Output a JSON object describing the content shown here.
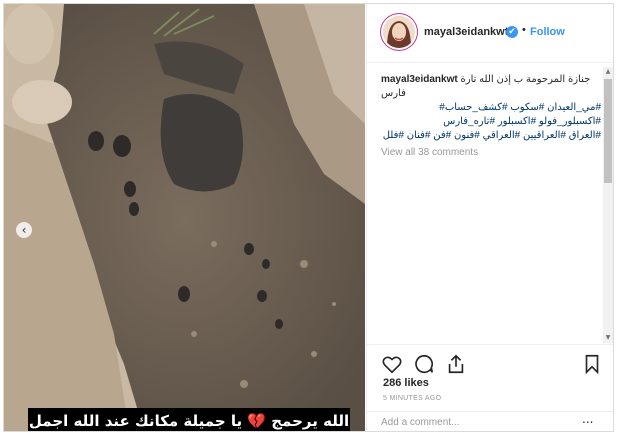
{
  "post": {
    "media": {
      "image_description": "muddy ground, carousel post",
      "overlay_caption": "الله يرحمج 💔 يا جميلة مكانك عند الله اجمل",
      "carousel_prev_icon": "chevron-left-icon"
    },
    "header": {
      "username": "mayal3eidankwt",
      "verified_icon": "✔",
      "separator": "•",
      "follow_label": "Follow"
    },
    "caption": {
      "username": "mayal3eidankwt",
      "text": "جنازة المرحومة ب إذن الله تارة فارس",
      "hashtags": [
        "#مي_العيدان #سكوب #كشف_حساب#",
        "#اكسبلور_فولو #اكسبلور #تاره_فارس",
        "#العراق #العراقيين #العراقي #فنون #فن #فنان #فلل"
      ]
    },
    "view_all_comments": "View all 38 comments",
    "actions": {
      "like_icon": "heart-icon",
      "comment_icon": "comment-bubble-icon",
      "share_icon": "share-icon",
      "save_icon": "bookmark-icon"
    },
    "likes": "286 likes",
    "timestamp": "5 MINUTES AGO",
    "add_comment": {
      "placeholder": "Add a comment...",
      "options": "..."
    },
    "colors": {
      "link": "#3897f0",
      "hashtag": "#003569",
      "muted": "#999999",
      "text": "#262626"
    }
  }
}
